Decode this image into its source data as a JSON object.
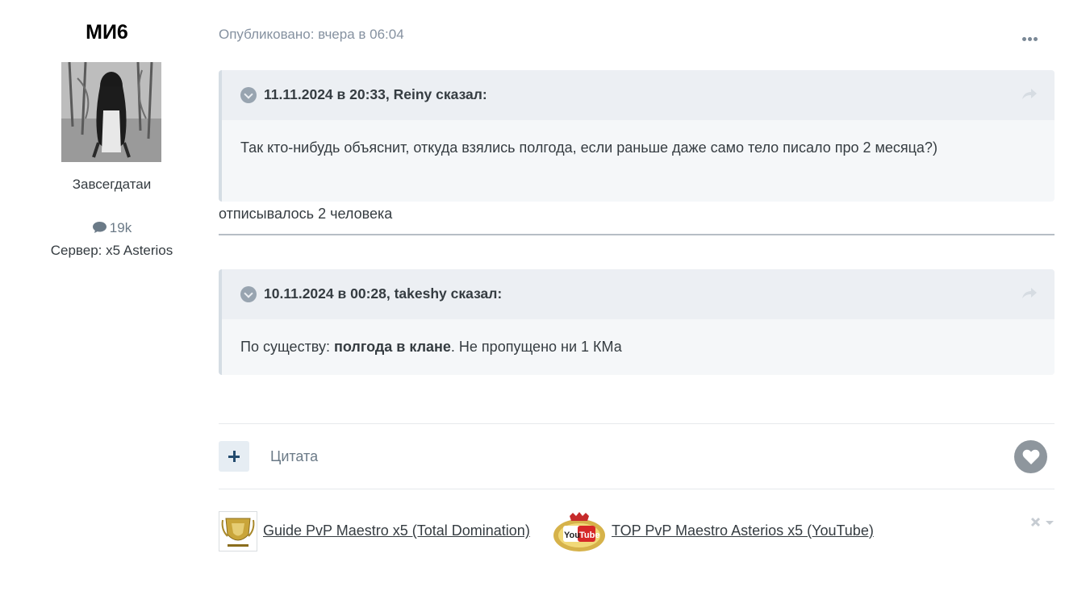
{
  "author": {
    "name": "МИ6",
    "rank": "Завсегдатаи",
    "posts_count": "19k",
    "server": "Сервер: x5 Asterios"
  },
  "post": {
    "meta": "Опубликовано: вчера в 06:04",
    "quotes": [
      {
        "cite": "11.11.2024 в 20:33, Reiny сказал:",
        "text": "Так кто-нибудь объяснит, откуда взялись полгода, если раньше даже само тело писало про 2 месяца?)"
      },
      {
        "cite": "10.11.2024 в 00:28, takeshy сказал:",
        "text_before": "По существу: ",
        "text_bold": "полгода в клане",
        "text_after": ". Не пропущено ни 1 КМа"
      }
    ],
    "reply_text": "отписывалось 2 человека"
  },
  "actions": {
    "quote_label": "Цитата"
  },
  "signature": {
    "link1": "Guide PvP Maestro x5 (Total Domination) ",
    "link2": "TOP PvP Maestro Asterios x5 (YouTube)",
    "img2_text": "You Tube"
  },
  "icons": {
    "more": "ellipsis-icon",
    "toggle": "chevron-down-circle-icon",
    "share": "share-arrow-icon",
    "comment": "comment-bubble-icon",
    "plus": "plus-icon",
    "like": "heart-icon",
    "hide": "close-caret-icon"
  }
}
